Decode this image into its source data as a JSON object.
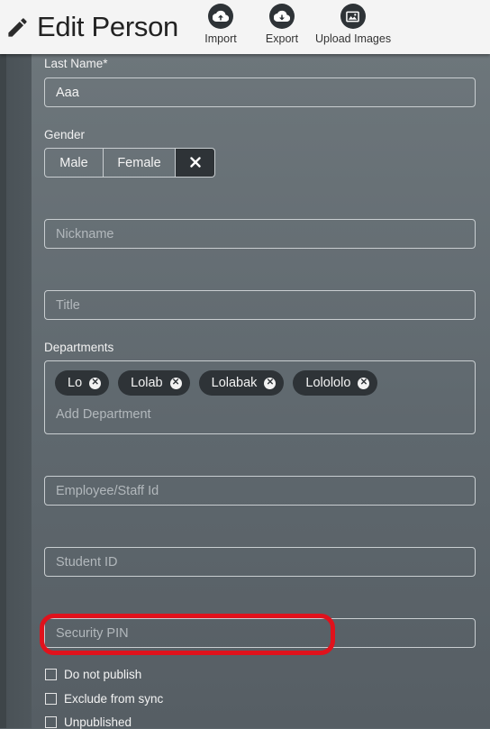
{
  "header": {
    "title": "Edit Person",
    "actions": [
      {
        "label": "Import",
        "icon": "cloud-upload-icon"
      },
      {
        "label": "Export",
        "icon": "cloud-download-icon"
      },
      {
        "label": "Upload Images",
        "icon": "image-icon"
      }
    ]
  },
  "form": {
    "last_name": {
      "label": "Last Name*",
      "value": "Aaa"
    },
    "gender": {
      "label": "Gender",
      "options": [
        "Male",
        "Female"
      ],
      "clear_icon": "close-icon"
    },
    "nickname": {
      "placeholder": "Nickname",
      "value": ""
    },
    "title": {
      "placeholder": "Title",
      "value": ""
    },
    "departments": {
      "label": "Departments",
      "tags": [
        "Lo",
        "Lolab",
        "Lolabak",
        "Lolololo"
      ],
      "placeholder": "Add Department"
    },
    "employee_id": {
      "placeholder": "Employee/Staff Id",
      "value": ""
    },
    "student_id": {
      "placeholder": "Student ID",
      "value": ""
    },
    "security_pin": {
      "placeholder": "Security PIN",
      "value": ""
    },
    "checkboxes": [
      {
        "label": "Do not publish",
        "checked": false
      },
      {
        "label": "Exclude from sync",
        "checked": false
      },
      {
        "label": "Unpublished",
        "checked": false
      }
    ]
  },
  "colors": {
    "highlight": "#e0121c",
    "dark_button": "#2e3337",
    "header_bg": "#f4f4f4"
  }
}
